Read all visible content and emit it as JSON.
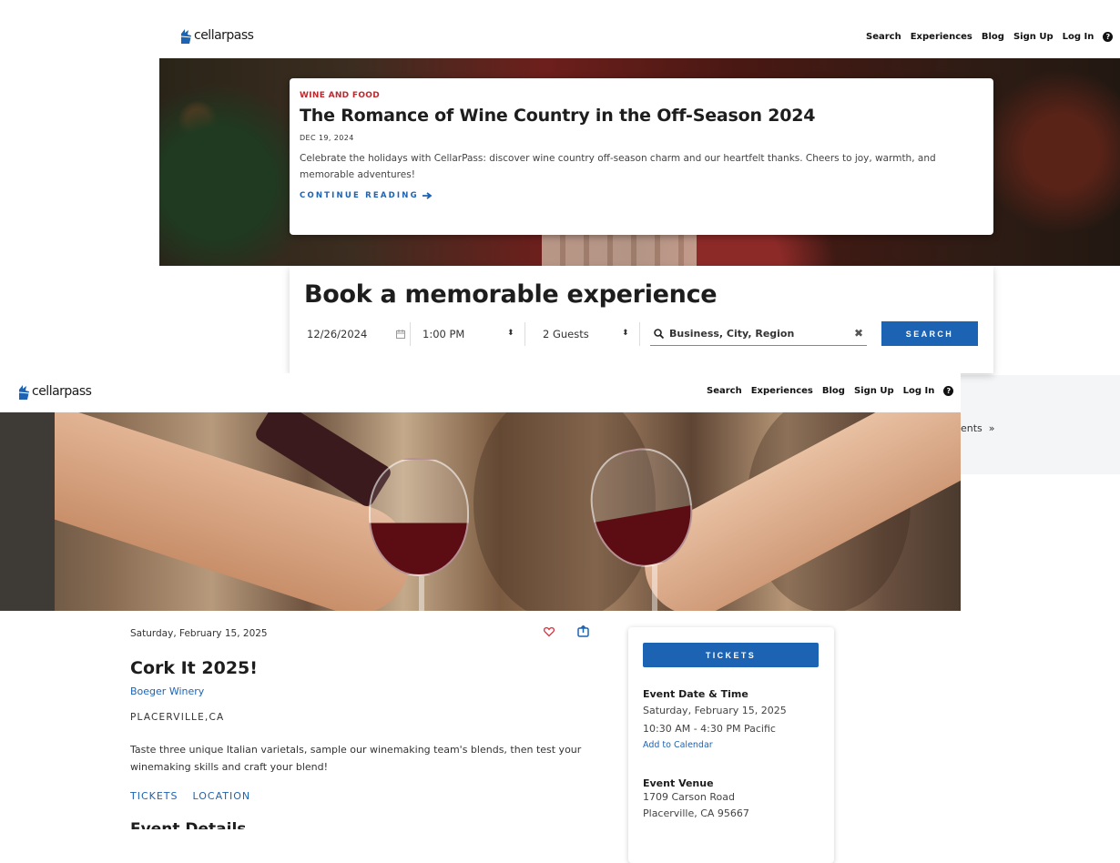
{
  "back_window": {
    "logo_text": "cellarpass",
    "nav": [
      "Search",
      "Experiences",
      "Blog",
      "Sign Up",
      "Log In"
    ],
    "blog": {
      "category": "WINE AND FOOD",
      "title": "The Romance of Wine Country in the Off-Season 2024",
      "date": "DEC 19, 2024",
      "excerpt": "Celebrate the holidays with CellarPass: discover wine country off-season charm and our heartfelt thanks. Cheers to joy, warmth, and memorable adventures!",
      "cta": "CONTINUE READING"
    },
    "booking": {
      "title": "Book a memorable experience",
      "date_value": "12/26/2024",
      "time_value": "1:00 PM",
      "guests_value": "2 Guests",
      "search_placeholder": "Business, City, Region",
      "search_button": "SEARCH"
    },
    "side_text": "ents"
  },
  "front_window": {
    "logo_text": "cellarpass",
    "nav": [
      "Search",
      "Experiences",
      "Blog",
      "Sign Up",
      "Log In"
    ],
    "event": {
      "date": "Saturday, February 15, 2025",
      "title": "Cork It 2025!",
      "winery": "Boeger Winery",
      "location": "PLACERVILLE,CA",
      "description": "Taste three unique Italian varietals, sample our winemaking team's blends, then test your winemaking skills and craft your blend!",
      "tabs": [
        "TICKETS",
        "LOCATION"
      ],
      "details_heading": "Event Details"
    },
    "ticket_card": {
      "button": "TICKETS",
      "datetime_heading": "Event Date & Time",
      "date_line": "Saturday, February 15, 2025",
      "time_line": "10:30 AM - 4:30 PM Pacific",
      "calendar_link": "Add to Calendar",
      "venue_heading": "Event Venue",
      "venue_line1": "1709 Carson Road",
      "venue_line2": "Placerville, CA 95667"
    }
  },
  "colors": {
    "brand_blue": "#1d63b3",
    "category_red": "#c0272d",
    "heart_red": "#d9333f"
  }
}
